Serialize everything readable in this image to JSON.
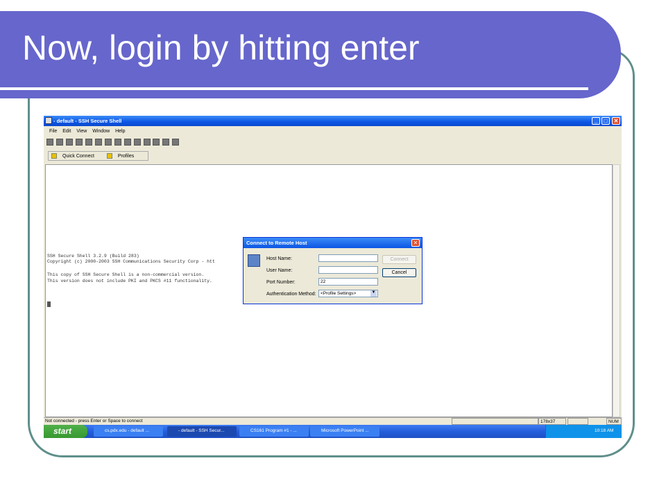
{
  "slide": {
    "title": "Now, login by hitting enter"
  },
  "window": {
    "title": "- default - SSH Secure Shell",
    "menu": [
      "File",
      "Edit",
      "View",
      "Window",
      "Help"
    ],
    "tabs": {
      "quick_connect": "Quick Connect",
      "profiles": "Profiles"
    }
  },
  "terminal": {
    "lines": [
      "SSH Secure Shell 3.2.9 (Build 283)",
      "Copyright (c) 2000-2003 SSH Communications Security Corp - htt",
      "",
      "This copy of SSH Secure Shell is a non-commercial version.",
      "This version does not include PKI and PKCS #11 functionality."
    ]
  },
  "dialog": {
    "title": "Connect to Remote Host",
    "host_label": "Host Name:",
    "host_value": "",
    "user_label": "User Name:",
    "user_value": "",
    "port_label": "Port Number:",
    "port_value": "22",
    "auth_label": "Authentication Method:",
    "auth_value": "<Profile Settings>",
    "connect_button": "Connect",
    "cancel_button": "Cancel"
  },
  "statusbar": {
    "message": "Not connected - press Enter or Space to connect",
    "size": "178x37",
    "num": "NUM"
  },
  "taskbar": {
    "start": "start",
    "tasks": [
      "cs.pdx.edu - default ...",
      "- default - SSH Secur...",
      "CS161 Program #1 - ...",
      "Microsoft PowerPoint ..."
    ],
    "clock": "10:18 AM"
  },
  "colors": {
    "title_band": "#6666cc",
    "frame": "#5f8f8b",
    "xp_blue": "#0b55e3"
  }
}
